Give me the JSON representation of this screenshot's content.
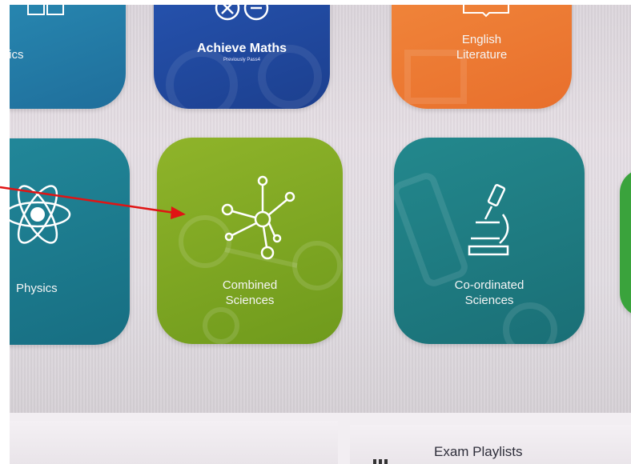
{
  "tiles": {
    "statistics": {
      "label": "tistics",
      "color": "#2a8fb7"
    },
    "achieve_maths": {
      "label": "Achieve Maths",
      "sublabel": "Previously Pass4",
      "color": "#2756b4"
    },
    "english_literature": {
      "label_line1": "English",
      "label_line2": "Literature",
      "color": "#f2893d"
    },
    "physics": {
      "label": "Physics",
      "color": "#22889a"
    },
    "combined_sciences": {
      "label_line1": "Combined",
      "label_line2": "Sciences",
      "color": "#8fb42a"
    },
    "coordinated_sciences": {
      "label_line1": "Co-ordinated",
      "label_line2": "Sciences",
      "color": "#23888d"
    }
  },
  "bottom": {
    "exam_playlists_label": "Exam Playlists"
  },
  "annotation": {
    "arrow_color": "#e01414"
  }
}
